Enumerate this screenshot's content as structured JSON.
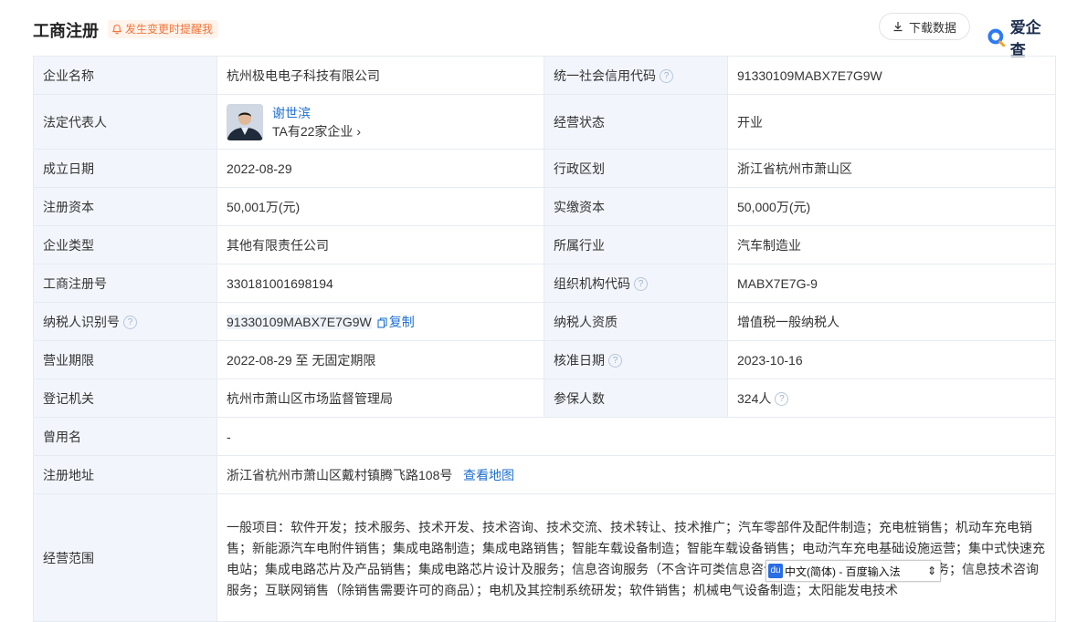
{
  "header": {
    "title": "工商注册",
    "remind_label": "发生变更时提醒我",
    "download_label": "下载数据",
    "brand_name": "爱企查"
  },
  "rows": [
    {
      "l1": "企业名称",
      "v1": "杭州极电电子科技有限公司",
      "l2": "统一社会信用代码",
      "v2": "91330109MABX7E7G9W"
    },
    {
      "l1": "法定代表人",
      "rep_name": "谢世滨",
      "rep_sub": "TA有22家企业",
      "l2": "经营状态",
      "v2": "开业"
    },
    {
      "l1": "成立日期",
      "v1": "2022-08-29",
      "l2": "行政区划",
      "v2": "浙江省杭州市萧山区"
    },
    {
      "l1": "注册资本",
      "v1": "50,001万(元)",
      "l2": "实缴资本",
      "v2": "50,000万(元)"
    },
    {
      "l1": "企业类型",
      "v1": "其他有限责任公司",
      "l2": "所属行业",
      "v2": "汽车制造业"
    },
    {
      "l1": "工商注册号",
      "v1": "330181001698194",
      "l2": "组织机构代码",
      "v2": "MABX7E7G-9"
    },
    {
      "l1": "纳税人识别号",
      "v1": "91330109MABX7E7G9W",
      "copy_label": "复制",
      "l2": "纳税人资质",
      "v2": "增值税一般纳税人"
    },
    {
      "l1": "营业期限",
      "v1": "2022-08-29 至 无固定期限",
      "l2": "核准日期",
      "v2": "2023-10-16"
    },
    {
      "l1": "登记机关",
      "v1": "杭州市萧山区市场监督管理局",
      "l2": "参保人数",
      "v2": "324人"
    },
    {
      "l1": "曾用名",
      "v1": "-"
    },
    {
      "l1": "注册地址",
      "v1": "浙江省杭州市萧山区戴村镇腾飞路108号",
      "map_label": "查看地图"
    },
    {
      "l1": "经营范围",
      "v1": "一般项目：软件开发；技术服务、技术开发、技术咨询、技术交流、技术转让、技术推广；汽车零部件及配件制造；充电桩销售；机动车充电销售；新能源汽车电附件销售；集成电路制造；集成电路销售；智能车载设备制造；智能车载设备销售；电动汽车充电基础设施运营；集中式快速充电站；集成电路芯片及产品销售；集成电路芯片设计及服务；信息咨询服务（不含许可类信息咨询服务）；信息系统运行维护服务；信息技术咨询服务；互联网销售（除销售需要许可的商品）；电机及其控制系统研发；软件销售；机械电气设备制造；太阳能发电技术"
    }
  ],
  "ime": {
    "logo": "du",
    "label": "中文(简体) - 百度输入法"
  }
}
